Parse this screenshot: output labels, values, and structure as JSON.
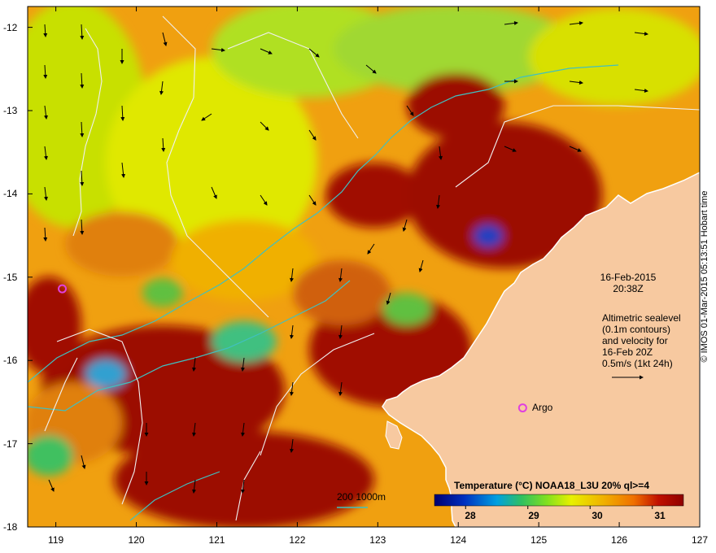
{
  "map": {
    "datetime_line1": "16-Feb-2015",
    "datetime_line2": "20:38Z",
    "altimetry_lines": [
      "Altimetric sealevel",
      "(0.1m contours)",
      "and velocity for",
      "16-Feb 20Z",
      "0.5m/s (1kt 24h)"
    ],
    "argo_label": "Argo",
    "isobath_label": "200  1000m",
    "credit": "© IMOS 01-Mar-2015 05:13:51 Hobart time",
    "x_ticks": [
      "119",
      "120",
      "121",
      "122",
      "123",
      "124",
      "125",
      "126",
      "127"
    ],
    "y_ticks": [
      "-12",
      "-13",
      "-14",
      "-15",
      "-16",
      "-17",
      "-18"
    ],
    "lon_range": [
      118.65,
      127.0
    ],
    "lat_range": [
      -18.0,
      -11.75
    ],
    "argo_markers": [
      {
        "lon": 119.08,
        "lat": -15.14
      },
      {
        "lon": 124.8,
        "lat": -16.57
      }
    ]
  },
  "colorbar": {
    "title": "Temperature (°C) NOAA18_L3U 20% ql>=4",
    "ticks": [
      "28",
      "29",
      "30",
      "31"
    ],
    "range": [
      27.5,
      31.5
    ],
    "stops": [
      "#000070",
      "#0030c0",
      "#00a0e0",
      "#30c060",
      "#80e020",
      "#e8f000",
      "#f0b000",
      "#f07000",
      "#c01000",
      "#900000"
    ]
  },
  "colors": {
    "land": "#f7c9a0",
    "warm_water": "#9c0a00",
    "isobath": "#40c0c0",
    "contour": "#f0f0f0",
    "argo": "#e040e0"
  }
}
